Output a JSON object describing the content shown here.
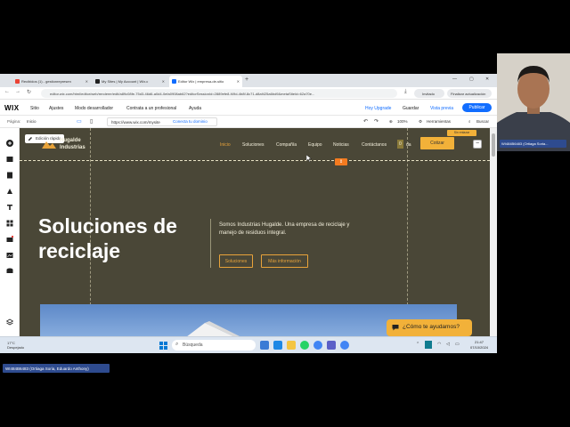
{
  "browser": {
    "tabs": [
      {
        "label": "Recibidos (1) - gestionrepresen",
        "favicon_color": "#ea4335"
      },
      {
        "label": "My Sites | My Account | Wix.c",
        "favicon_color": "#222222"
      },
      {
        "label": "Editor Wix | empresa-de-sitio",
        "favicon_color": "#116dff"
      }
    ],
    "new_tab": "+",
    "url": "editor.wix.com/html/editor/web/renderer/edit/a89c08fe-75d3-46d6-a0d4-0efa0908ab62?editorSessionId=2889efe8-f49d-4b8f-8c71-d8af425a6bd9&metaSiteId=62a70e...",
    "invitado": "Invitado",
    "finalizar": "Finalizar actualización"
  },
  "wix": {
    "logo": "WIX",
    "menu": [
      "Sitio",
      "Ajustes",
      "Modo desarrollador",
      "Contrata a un profesional",
      "Ayuda"
    ],
    "hoy_upgrade": "Hoy Upgrade",
    "guardar": "Guardar",
    "vista_previa": "Vista previa",
    "publicar": "Publicar",
    "pagina_label": "Página:",
    "pagina_value": "Inicio",
    "site_url": "https://www.wix.com/mysite",
    "conectar_dominio": "Conecta tu dominio",
    "zoom": "100%",
    "herramientas": "Herramientas",
    "buscar": "Buscar"
  },
  "site": {
    "quick_edit": "Edición rápida",
    "logo_line1": "Hugalde",
    "logo_line2": "Industrias",
    "nav": [
      "Inicio",
      "Soluciones",
      "Compañía",
      "Equipo",
      "Noticias",
      "Contáctanos"
    ],
    "nav_partial": "da",
    "cotizar": "Cotizar",
    "sin_enlace": "Sin enlazar",
    "hero_title_line1": "Soluciones de",
    "hero_title_line2": "reciclaje",
    "hero_text": "Somos Industrias Hugalde. Una empresa de reciclaje y manejo de residuos integral.",
    "btn_soluciones": "Soluciones",
    "btn_mas_info": "Más información",
    "chat": "¿Cómo te ayudamos?"
  },
  "taskbar": {
    "weather_temp": "17°C",
    "weather_desc": "Despejado",
    "search": "Búsqueda",
    "time": "21:47",
    "date": "07/10/2024"
  },
  "call": {
    "remote_name": "WI484B6483 (Ortiaga Soria...",
    "self_name": "WI484B6483 (Ortiaga Soria, Eduardo Anthony)"
  },
  "colors": {
    "site_bg": "#4a4737",
    "accent": "#f2b139",
    "wix_blue": "#116dff"
  }
}
